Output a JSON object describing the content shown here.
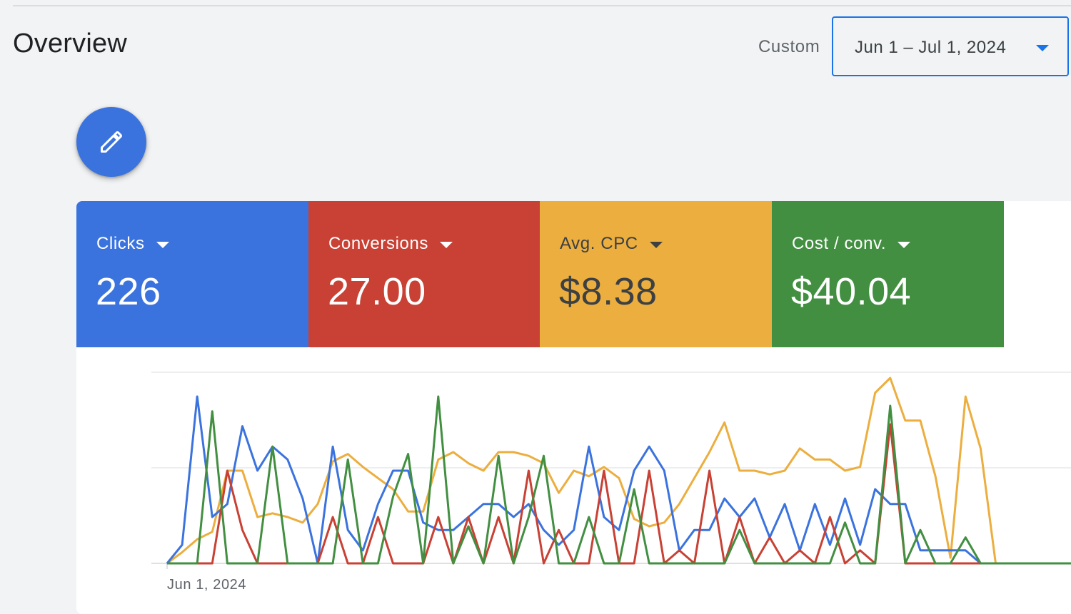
{
  "header": {
    "title": "Overview",
    "range_type_label": "Custom",
    "date_range": "Jun 1 – Jul 1, 2024"
  },
  "edit_button": {
    "icon": "pencil-icon"
  },
  "scorecards": [
    {
      "label": "Clicks",
      "value": "226",
      "color": "#3b73de",
      "text_color": "#ffffff"
    },
    {
      "label": "Conversions",
      "value": "27.00",
      "color": "#c84134",
      "text_color": "#ffffff"
    },
    {
      "label": "Avg. CPC",
      "value": "$8.38",
      "color": "#ecae3e",
      "text_color": "#3c4043"
    },
    {
      "label": "Cost / conv.",
      "value": "$40.04",
      "color": "#428f41",
      "text_color": "#ffffff"
    }
  ],
  "chart_data": {
    "type": "line",
    "x_start_label": "Jun 1, 2024",
    "grid": true,
    "y_fraction_of_max": true,
    "series": [
      {
        "name": "Clicks",
        "color": "#3b73de",
        "values": [
          0,
          0.1,
          0.9,
          0.25,
          0.32,
          0.74,
          0.5,
          0.63,
          0.56,
          0.35,
          0,
          0.63,
          0.18,
          0.07,
          0.32,
          0.5,
          0.5,
          0.22,
          0.18,
          0.18,
          0.25,
          0.32,
          0.32,
          0.25,
          0.32,
          0.18,
          0.1,
          0.18,
          0.63,
          0.25,
          0.18,
          0.5,
          0.63,
          0.5,
          0.07,
          0.18,
          0.18,
          0.35,
          0.25,
          0.35,
          0.14,
          0.32,
          0.07,
          0.32,
          0.1,
          0.35,
          0.1,
          0.4,
          0.32,
          0.32,
          0.07,
          0.07,
          0.07,
          0.07,
          0,
          0,
          0,
          0,
          0,
          0,
          0
        ]
      },
      {
        "name": "Conversions",
        "color": "#c84134",
        "values": [
          0,
          0,
          0,
          0,
          0.5,
          0.18,
          0,
          0,
          0,
          0,
          0,
          0.25,
          0,
          0,
          0.25,
          0,
          0,
          0,
          0.25,
          0,
          0.25,
          0,
          0.25,
          0,
          0.5,
          0,
          0.18,
          0,
          0,
          0.5,
          0,
          0,
          0.5,
          0,
          0.07,
          0,
          0.5,
          0,
          0.25,
          0,
          0.14,
          0,
          0.07,
          0,
          0.25,
          0,
          0.07,
          0,
          0.75,
          0,
          0,
          0,
          0,
          0,
          0,
          0,
          0,
          0,
          0,
          0,
          0
        ]
      },
      {
        "name": "Avg. CPC",
        "color": "#ecae3e",
        "values": [
          0,
          0.06,
          0.13,
          0.17,
          0.5,
          0.5,
          0.25,
          0.27,
          0.25,
          0.22,
          0.32,
          0.55,
          0.59,
          0.52,
          0.46,
          0.4,
          0.28,
          0.28,
          0.56,
          0.6,
          0.54,
          0.5,
          0.6,
          0.6,
          0.58,
          0.54,
          0.38,
          0.5,
          0.47,
          0.52,
          0.46,
          0.24,
          0.2,
          0.22,
          0.32,
          0.46,
          0.6,
          0.76,
          0.5,
          0.5,
          0.48,
          0.5,
          0.62,
          0.56,
          0.56,
          0.5,
          0.52,
          0.92,
          1.0,
          0.77,
          0.77,
          0.47,
          0.03,
          0.9,
          0.62,
          0,
          0,
          0,
          0,
          0,
          0
        ]
      },
      {
        "name": "Cost / conv.",
        "color": "#428f41",
        "values": [
          0,
          0,
          0,
          0.82,
          0,
          0,
          0,
          0.63,
          0,
          0,
          0,
          0,
          0.56,
          0,
          0,
          0.36,
          0.59,
          0,
          0.9,
          0,
          0.2,
          0,
          0.58,
          0,
          0.25,
          0.58,
          0,
          0,
          0.25,
          0,
          0,
          0.4,
          0,
          0,
          0,
          0,
          0,
          0,
          0.18,
          0,
          0,
          0,
          0,
          0,
          0,
          0.22,
          0,
          0,
          0.85,
          0,
          0.18,
          0,
          0,
          0.14,
          0,
          0,
          0,
          0,
          0,
          0,
          0
        ]
      }
    ]
  }
}
